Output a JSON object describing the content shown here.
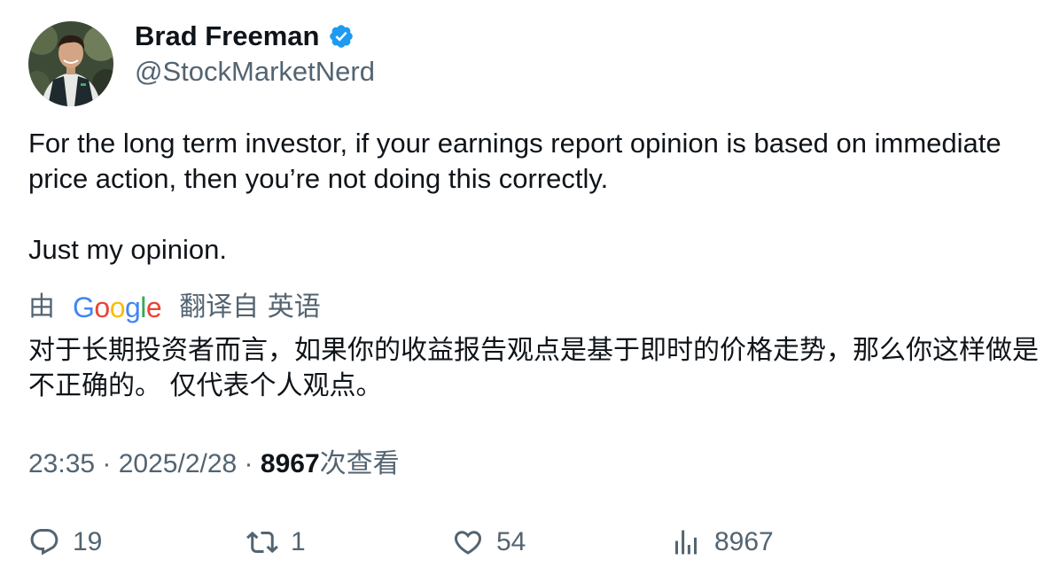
{
  "author": {
    "name": "Brad Freeman",
    "handle": "@StockMarketNerd",
    "verified_color": "#1d9bf0"
  },
  "tweet": {
    "paragraphs": [
      "For the long term investor, if your earnings report opinion is based on immediate price action, then you’re not doing this correctly.",
      "Just my opinion."
    ]
  },
  "translation": {
    "prefix": "由",
    "provider": "Google",
    "suffix": "翻译自 英语",
    "text": "对于长期投资者而言，如果你的收益报告观点是基于即时的价格走势，那么你这样做是不正确的。 仅代表个人观点。"
  },
  "meta": {
    "time": "23:35",
    "separator": " · ",
    "date": "2025/2/28",
    "views_count": "8967",
    "views_label": "次查看"
  },
  "actions": {
    "replies": "19",
    "retweets": "1",
    "likes": "54",
    "views": "8967"
  },
  "colors": {
    "text": "#0f1419",
    "secondary": "#536471",
    "brand_blue": "#1d9bf0"
  }
}
